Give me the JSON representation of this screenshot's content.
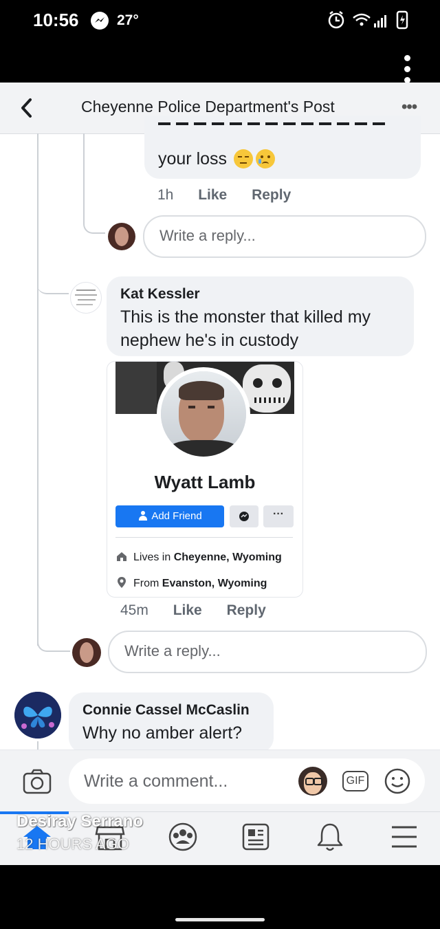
{
  "status_bar": {
    "time": "10:56",
    "temperature": "27°"
  },
  "header": {
    "title": "Cheyenne Police Department's Post"
  },
  "comments": [
    {
      "text_fragment": "your loss",
      "time": "1h",
      "like": "Like",
      "reply": "Reply",
      "reply_placeholder": "Write a reply..."
    },
    {
      "author": "Kat Kessler",
      "text_line1": "This is the monster that killed my",
      "text_line2": "nephew he's in custody",
      "time": "45m",
      "like": "Like",
      "reply": "Reply",
      "reply_placeholder": "Write a reply..."
    },
    {
      "author": "Connie Cassel McCaslin",
      "text": "Why no amber alert?"
    }
  ],
  "profile_card": {
    "name": "Wyatt Lamb",
    "add_friend_label": "Add Friend",
    "more_label": "···",
    "lives_in_prefix": "Lives in",
    "lives_in_place": "Cheyenne, Wyoming",
    "from_prefix": "From",
    "from_place": "Evanston, Wyoming"
  },
  "composer": {
    "placeholder": "Write a comment...",
    "gif_label": "GIF"
  },
  "watermark": {
    "name": "Desiray Serrano",
    "time": "12 HOURS AGO"
  },
  "bottom_nav": [
    "home-icon",
    "marketplace-icon",
    "groups-icon",
    "news-icon",
    "notifications-icon",
    "menu-icon"
  ],
  "colors": {
    "accent": "#1877f2",
    "bubble": "#f0f2f5",
    "thread_line": "#ccd0d5"
  }
}
